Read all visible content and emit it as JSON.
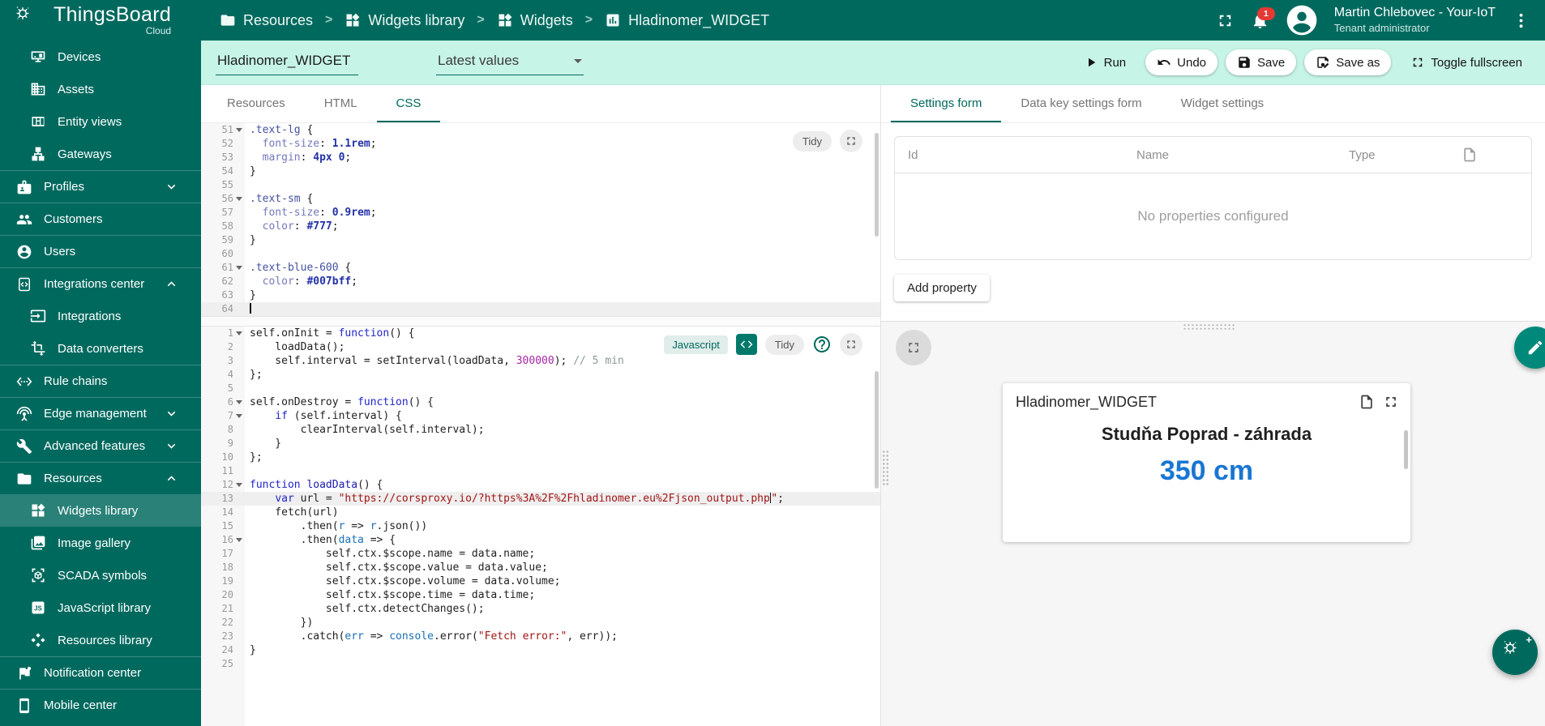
{
  "colors": {
    "primary": "#00695e",
    "toolbar_bg": "#c6f4e6",
    "notification_badge": "#e53935",
    "widget_value_blue": "#1976d2"
  },
  "topbar": {
    "logo": {
      "title": "ThingsBoard",
      "subtitle": "Cloud"
    },
    "breadcrumbs": [
      {
        "icon": "folder-icon",
        "label": "Resources"
      },
      {
        "icon": "widgets-icon",
        "label": "Widgets library"
      },
      {
        "icon": "widgets-icon",
        "label": "Widgets"
      },
      {
        "icon": "chart-icon",
        "label": "Hladinomer_WIDGET"
      }
    ],
    "notification_count": "1",
    "user": {
      "name": "Martin Chlebovec - Your-IoT",
      "role": "Tenant administrator"
    }
  },
  "toolbar": {
    "widget_name": "Hladinomer_WIDGET",
    "bundle_select": "Latest values",
    "run_label": "Run",
    "undo_label": "Undo",
    "save_label": "Save",
    "save_as_label": "Save as",
    "toggle_fullscreen_label": "Toggle fullscreen"
  },
  "sidebar": {
    "items": [
      {
        "label": "Devices",
        "icon": "devices-icon",
        "level": 1
      },
      {
        "label": "Assets",
        "icon": "assets-icon",
        "level": 1
      },
      {
        "label": "Entity views",
        "icon": "entity-views-icon",
        "level": 1
      },
      {
        "label": "Gateways",
        "icon": "gateways-icon",
        "level": 1
      },
      {
        "label": "Profiles",
        "icon": "profiles-icon",
        "level": 0,
        "chevron": "down",
        "divider": true
      },
      {
        "label": "Customers",
        "icon": "customers-icon",
        "level": 0,
        "divider": true
      },
      {
        "label": "Users",
        "icon": "users-icon",
        "level": 0,
        "divider": true
      },
      {
        "label": "Integrations center",
        "icon": "integrations-center-icon",
        "level": 0,
        "chevron": "up",
        "divider": true
      },
      {
        "label": "Integrations",
        "icon": "integrations-icon",
        "level": 1
      },
      {
        "label": "Data converters",
        "icon": "data-converters-icon",
        "level": 1
      },
      {
        "label": "Rule chains",
        "icon": "rule-chains-icon",
        "level": 0,
        "divider": true
      },
      {
        "label": "Edge management",
        "icon": "edge-management-icon",
        "level": 0,
        "chevron": "down",
        "divider": true
      },
      {
        "label": "Advanced features",
        "icon": "hammer-wrench-icon",
        "level": 0,
        "chevron": "down",
        "divider": true
      },
      {
        "label": "Resources",
        "icon": "folder-icon",
        "level": 0,
        "chevron": "up",
        "divider": true
      },
      {
        "label": "Widgets library",
        "icon": "widgets-icon",
        "level": 1,
        "selected": true
      },
      {
        "label": "Image gallery",
        "icon": "image-gallery-icon",
        "level": 1
      },
      {
        "label": "SCADA symbols",
        "icon": "scada-icon",
        "level": 1
      },
      {
        "label": "JavaScript library",
        "icon": "js-library-icon",
        "level": 1
      },
      {
        "label": "Resources library",
        "icon": "resources-library-icon",
        "level": 1
      },
      {
        "label": "Notification center",
        "icon": "notification-center-icon",
        "level": 0,
        "divider": true
      },
      {
        "label": "Mobile center",
        "icon": "mobile-center-icon",
        "level": 0,
        "divider": true
      }
    ]
  },
  "editor": {
    "tabs": [
      "Resources",
      "HTML",
      "CSS"
    ],
    "active_tab": "CSS",
    "css": {
      "tidy_label": "Tidy",
      "lines": [
        {
          "n": 51,
          "f": true,
          "t": [
            [
              "sel",
              ".text-lg"
            ],
            [
              "d",
              " {"
            ]
          ]
        },
        {
          "n": 52,
          "t": [
            [
              "d",
              "  "
            ],
            [
              "prop",
              "font-size"
            ],
            [
              "d",
              ": "
            ],
            [
              "val",
              "1.1rem"
            ],
            [
              "d",
              ";"
            ]
          ]
        },
        {
          "n": 53,
          "t": [
            [
              "d",
              "  "
            ],
            [
              "prop",
              "margin"
            ],
            [
              "d",
              ": "
            ],
            [
              "val",
              "4px 0"
            ],
            [
              "d",
              ";"
            ]
          ]
        },
        {
          "n": 54,
          "t": [
            [
              "d",
              "}"
            ]
          ]
        },
        {
          "n": 55,
          "t": []
        },
        {
          "n": 56,
          "f": true,
          "t": [
            [
              "sel",
              ".text-sm"
            ],
            [
              "d",
              " {"
            ]
          ]
        },
        {
          "n": 57,
          "t": [
            [
              "d",
              "  "
            ],
            [
              "prop",
              "font-size"
            ],
            [
              "d",
              ": "
            ],
            [
              "val",
              "0.9rem"
            ],
            [
              "d",
              ";"
            ]
          ]
        },
        {
          "n": 58,
          "t": [
            [
              "d",
              "  "
            ],
            [
              "prop",
              "color"
            ],
            [
              "d",
              ": "
            ],
            [
              "val",
              "#777"
            ],
            [
              "d",
              ";"
            ]
          ]
        },
        {
          "n": 59,
          "t": [
            [
              "d",
              "}"
            ]
          ]
        },
        {
          "n": 60,
          "t": []
        },
        {
          "n": 61,
          "f": true,
          "t": [
            [
              "sel",
              ".text-blue-600"
            ],
            [
              "d",
              " {"
            ]
          ]
        },
        {
          "n": 62,
          "t": [
            [
              "d",
              "  "
            ],
            [
              "prop",
              "color"
            ],
            [
              "d",
              ": "
            ],
            [
              "val",
              "#007bff"
            ],
            [
              "d",
              ";"
            ]
          ]
        },
        {
          "n": 63,
          "t": [
            [
              "d",
              "}"
            ]
          ]
        },
        {
          "n": 64,
          "a": true,
          "t": [
            [
              "cur",
              ""
            ]
          ]
        }
      ]
    },
    "js": {
      "language_badge": "Javascript",
      "tidy_label": "Tidy",
      "lines": [
        {
          "n": 1,
          "f": true,
          "t": [
            [
              "d",
              "self.onInit = "
            ],
            [
              "k",
              "function"
            ],
            [
              "d",
              "() {"
            ]
          ]
        },
        {
          "n": 2,
          "t": [
            [
              "d",
              "    loadData();"
            ]
          ]
        },
        {
          "n": 3,
          "t": [
            [
              "d",
              "    self.interval = setInterval(loadData, "
            ],
            [
              "n",
              "300000"
            ],
            [
              "d",
              "); "
            ],
            [
              "c",
              "// 5 min"
            ]
          ]
        },
        {
          "n": 4,
          "t": [
            [
              "d",
              "};"
            ]
          ]
        },
        {
          "n": 5,
          "t": []
        },
        {
          "n": 6,
          "f": true,
          "t": [
            [
              "d",
              "self.onDestroy = "
            ],
            [
              "k",
              "function"
            ],
            [
              "d",
              "() {"
            ]
          ]
        },
        {
          "n": 7,
          "f": true,
          "t": [
            [
              "d",
              "    "
            ],
            [
              "k",
              "if"
            ],
            [
              "d",
              " (self.interval) {"
            ]
          ]
        },
        {
          "n": 8,
          "t": [
            [
              "d",
              "        clearInterval(self.interval);"
            ]
          ]
        },
        {
          "n": 9,
          "t": [
            [
              "d",
              "    }"
            ]
          ]
        },
        {
          "n": 10,
          "t": [
            [
              "d",
              "};"
            ]
          ]
        },
        {
          "n": 11,
          "t": []
        },
        {
          "n": 12,
          "f": true,
          "t": [
            [
              "k",
              "function"
            ],
            [
              "def",
              " loadData"
            ],
            [
              "d",
              "() {"
            ]
          ]
        },
        {
          "n": 13,
          "a": true,
          "t": [
            [
              "d",
              "    "
            ],
            [
              "k",
              "var"
            ],
            [
              "d",
              " url = "
            ],
            [
              "s",
              "\"https://corsproxy.io/?https%3A%2F%2Fhladinomer.eu%2Fjson_output.php"
            ],
            [
              "cur",
              ""
            ],
            [
              "s",
              "\""
            ],
            [
              "d",
              ";"
            ]
          ]
        },
        {
          "n": 14,
          "t": [
            [
              "d",
              "    fetch(url)"
            ]
          ]
        },
        {
          "n": 15,
          "t": [
            [
              "d",
              "        .then("
            ],
            [
              "v2",
              "r"
            ],
            [
              "d",
              " => "
            ],
            [
              "v2",
              "r"
            ],
            [
              "d",
              ".json())"
            ]
          ]
        },
        {
          "n": 16,
          "f": true,
          "t": [
            [
              "d",
              "        .then("
            ],
            [
              "v2",
              "data"
            ],
            [
              "d",
              " => {"
            ]
          ]
        },
        {
          "n": 17,
          "t": [
            [
              "d",
              "            self.ctx.$scope.name = data.name;"
            ]
          ]
        },
        {
          "n": 18,
          "t": [
            [
              "d",
              "            self.ctx.$scope.value = data.value;"
            ]
          ]
        },
        {
          "n": 19,
          "t": [
            [
              "d",
              "            self.ctx.$scope.volume = data.volume;"
            ]
          ]
        },
        {
          "n": 20,
          "t": [
            [
              "d",
              "            self.ctx.$scope.time = data.time;"
            ]
          ]
        },
        {
          "n": 21,
          "t": [
            [
              "d",
              "            self.ctx.detectChanges();"
            ]
          ]
        },
        {
          "n": 22,
          "t": [
            [
              "d",
              "        })"
            ]
          ]
        },
        {
          "n": 23,
          "t": [
            [
              "d",
              "        .catch("
            ],
            [
              "v2",
              "err"
            ],
            [
              "d",
              " => "
            ],
            [
              "v2",
              "console"
            ],
            [
              "d",
              ".error("
            ],
            [
              "s",
              "\"Fetch error:\""
            ],
            [
              "d",
              ", err));"
            ]
          ]
        },
        {
          "n": 24,
          "t": [
            [
              "d",
              "}"
            ]
          ]
        },
        {
          "n": 25,
          "t": []
        }
      ]
    }
  },
  "settings_panel": {
    "tabs": [
      "Settings form",
      "Data key settings form",
      "Widget settings"
    ],
    "active_tab": "Settings form",
    "table": {
      "columns": [
        "Id",
        "Name",
        "Type"
      ],
      "empty_text": "No properties configured"
    },
    "add_property_label": "Add property"
  },
  "preview": {
    "card": {
      "title": "Hladinomer_WIDGET",
      "name": "Studňa Poprad - záhrada",
      "value": "350 cm",
      "value_color": "#1976d2"
    }
  }
}
